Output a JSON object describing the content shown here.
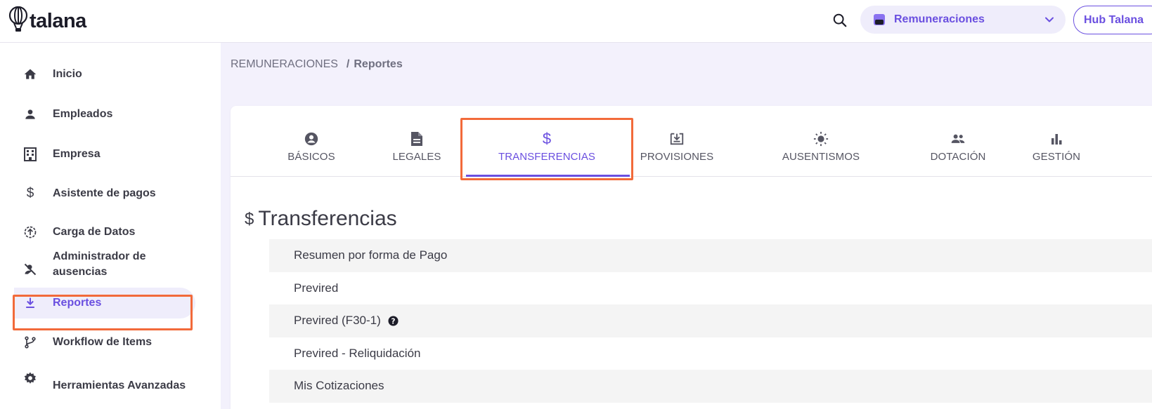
{
  "app": {
    "logo_text": "talana",
    "module_selector": {
      "selected": "Remuneraciones"
    },
    "hub_button": "Hub Talana"
  },
  "sidebar": {
    "items": [
      {
        "label": "Inicio",
        "icon": "home-icon"
      },
      {
        "label": "Empleados",
        "icon": "person-icon"
      },
      {
        "label": "Empresa",
        "icon": "building-icon"
      },
      {
        "label": "Asistente de pagos",
        "icon": "dollar-icon"
      },
      {
        "label": "Carga de Datos",
        "icon": "upload-circle-icon"
      },
      {
        "label": "Administrador de ausencias",
        "icon": "person-off-icon"
      },
      {
        "label": "Reportes",
        "icon": "download-icon",
        "active": true
      },
      {
        "label": "Workflow de Items",
        "icon": "branch-icon"
      },
      {
        "label": "Herramientas Avanzadas",
        "icon": "gear-icon"
      }
    ]
  },
  "breadcrumb": {
    "parent": "REMUNERACIONES",
    "separator": "/",
    "current": "Reportes"
  },
  "tabs": [
    {
      "label": "BÁSICOS",
      "icon": "account-circle-icon"
    },
    {
      "label": "LEGALES",
      "icon": "document-icon"
    },
    {
      "label": "TRANSFERENCIAS",
      "icon": "dollar-icon",
      "active": true
    },
    {
      "label": "PROVISIONES",
      "icon": "download-box-icon"
    },
    {
      "label": "AUSENTISMOS",
      "icon": "sun-icon"
    },
    {
      "label": "DOTACIÓN",
      "icon": "people-icon"
    },
    {
      "label": "GESTIÓN",
      "icon": "bar-chart-icon"
    }
  ],
  "section": {
    "icon_text": "$",
    "title": "Transferencias"
  },
  "reports": [
    {
      "label": "Resumen por forma de Pago"
    },
    {
      "label": "Previred"
    },
    {
      "label": "Previred (F30-1)",
      "help_icon": "help-circle-icon"
    },
    {
      "label": "Previred - Reliquidación"
    },
    {
      "label": "Mis Cotizaciones"
    }
  ],
  "colors": {
    "accent": "#6a4fe0",
    "highlight": "#f26a3a",
    "sidebar_active_bg": "#efedfb"
  }
}
